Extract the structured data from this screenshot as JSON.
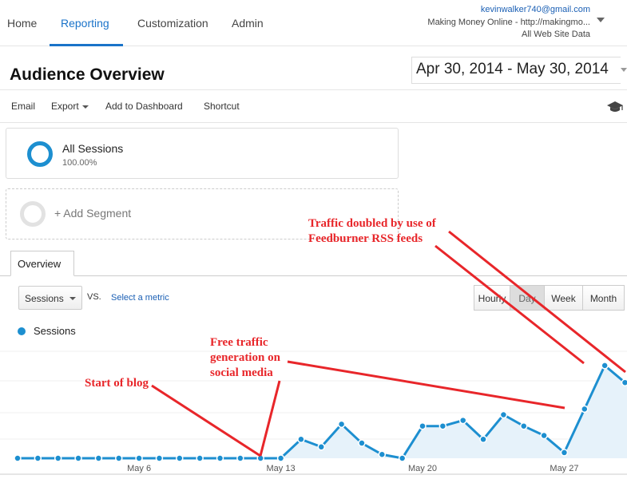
{
  "nav": {
    "items": [
      "Home",
      "Reporting",
      "Customization",
      "Admin"
    ],
    "active": "Reporting"
  },
  "account": {
    "email": "kevinwalker740@gmail.com",
    "property": "Making Money Online - http://makingmo...",
    "view": "All Web Site Data"
  },
  "page": {
    "title": "Audience Overview",
    "date_range": "Apr 30, 2014 - May 30, 2014"
  },
  "toolbar": {
    "email": "Email",
    "export": "Export",
    "add_dashboard": "Add to Dashboard",
    "shortcut": "Shortcut",
    "help_icon": "graduation-cap-icon"
  },
  "segments": {
    "all_sessions": "All Sessions",
    "all_sessions_pct": "100.00%",
    "add_segment": "+ Add Segment"
  },
  "tabs": {
    "overview": "Overview"
  },
  "controls": {
    "metric": "Sessions",
    "vs": "VS.",
    "select_metric": "Select a metric",
    "periods": [
      "Hourly",
      "Day",
      "Week",
      "Month"
    ],
    "active_period": "Day"
  },
  "chart_data": {
    "type": "area",
    "series": [
      {
        "name": "Sessions",
        "color": "#1d8fd0",
        "values": [
          0,
          0,
          0,
          0,
          0,
          0,
          0,
          0,
          0,
          0,
          0,
          0,
          0,
          0,
          1,
          0.6,
          1.8,
          0.8,
          0.2,
          0,
          1.7,
          1.7,
          2.0,
          1.0,
          2.3,
          1.7,
          1.2,
          0.3,
          2.6,
          4.9,
          4.0,
          4.3
        ]
      }
    ],
    "x_start": "Apr 30",
    "x_ticks": [
      "May 6",
      "May 13",
      "May 20",
      "May 27"
    ],
    "y_tick_labels": [],
    "grid": true
  },
  "annotations": {
    "start": "Start of blog",
    "social": [
      "Free traffic",
      "generation on",
      "social media"
    ],
    "rss": [
      "Traffic doubled by use of",
      "Feedburner RSS feeds"
    ]
  }
}
